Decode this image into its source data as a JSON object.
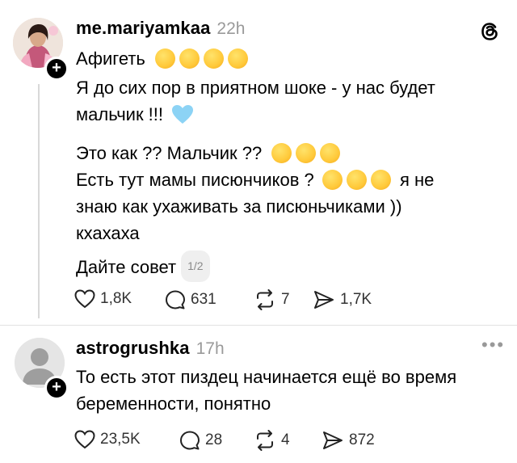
{
  "posts": [
    {
      "username": "me.mariyamkaa",
      "time": "22h",
      "lines": [
        "Афигеть",
        "Я до сих пор в приятном шоке - у нас будет",
        "мальчик !!!",
        "Это как ?? Мальчик ??",
        "Есть тут мамы писюнчиков ?",
        "я не",
        "знаю как ухаживать за писюньчиками ))",
        "кхахаха",
        "Дайте совет"
      ],
      "pager": "1/2",
      "stats": {
        "likes": "1,8K",
        "replies": "631",
        "reposts": "7",
        "shares": "1,7K"
      }
    },
    {
      "username": "astrogrushka",
      "time": "17h",
      "lines": [
        "То есть этот пиздец начинается ещё во время",
        "беременности, понятно"
      ],
      "stats": {
        "likes": "23,5K",
        "replies": "28",
        "reposts": "4",
        "shares": "872"
      }
    }
  ],
  "icons": {
    "logo": "threads-logo-icon",
    "like": "heart-icon",
    "reply": "comment-icon",
    "repost": "repost-icon",
    "share": "send-icon",
    "more": "more-dots-icon",
    "heart_emoji": "light-blue-heart-emoji",
    "emoji_colors": [
      "#ffc93a"
    ]
  },
  "colors": {
    "text": "#000000",
    "muted": "#9a9a9a",
    "divider": "#e2e2e2",
    "heart_emoji": "#8cd3f5"
  }
}
